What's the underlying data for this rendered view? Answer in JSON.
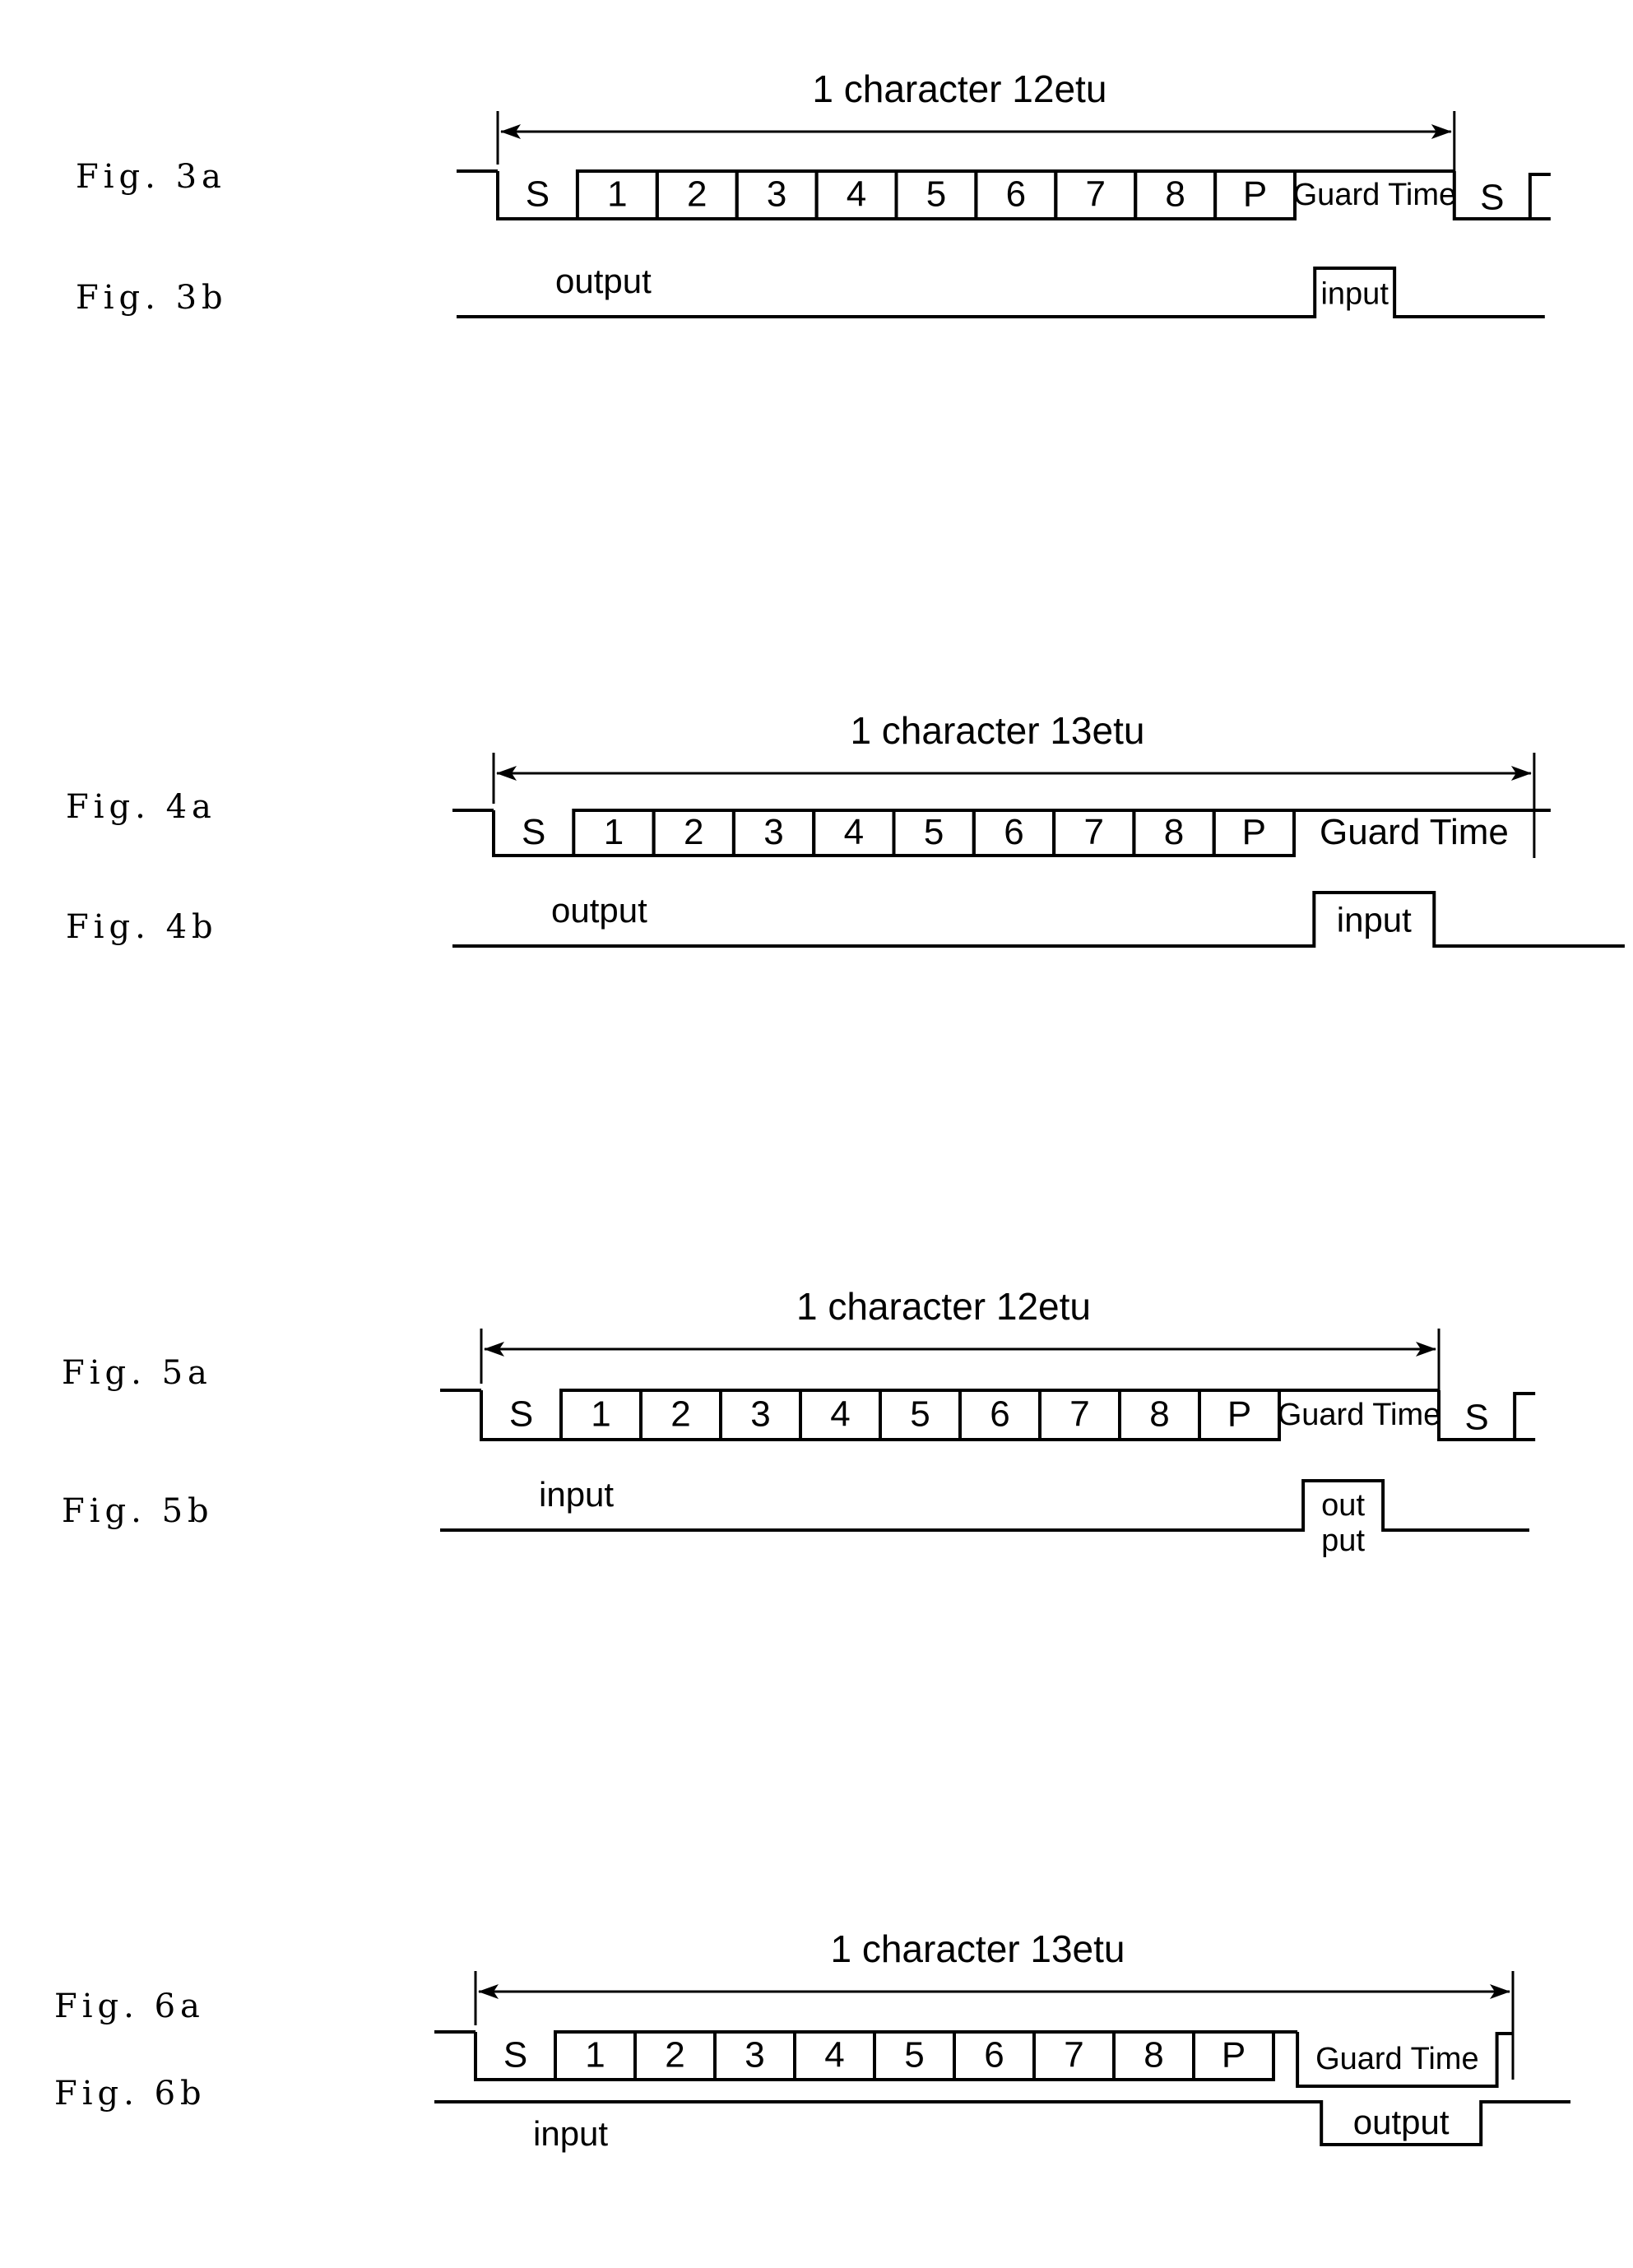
{
  "page": {
    "background": "#ffffff",
    "ink": "#000000"
  },
  "figures": [
    {
      "id": "fig3",
      "label_a": "Fig. 3a",
      "label_b": "Fig. 3b",
      "title": "1 character 12etu",
      "total_etu": 12,
      "cells": [
        "S",
        "1",
        "2",
        "3",
        "4",
        "5",
        "6",
        "7",
        "8",
        "P"
      ],
      "guard_label": "Guard Time",
      "guard_etu": 2,
      "next_start": true,
      "next_start_label": "S",
      "guard_boxed": false,
      "row_b_main_label": "output",
      "row_b_pulse_label": "input",
      "row_b_pulse_direction": "up",
      "row_b_pulse_width_etu": 1
    },
    {
      "id": "fig4",
      "label_a": "Fig. 4a",
      "label_b": "Fig. 4b",
      "title": "1 character 13etu",
      "total_etu": 13,
      "cells": [
        "S",
        "1",
        "2",
        "3",
        "4",
        "5",
        "6",
        "7",
        "8",
        "P"
      ],
      "guard_label": "Guard Time",
      "guard_etu": 3,
      "next_start": false,
      "guard_boxed": false,
      "row_b_main_label": "output",
      "row_b_pulse_label": "input",
      "row_b_pulse_direction": "up",
      "row_b_pulse_width_etu": 1.5
    },
    {
      "id": "fig5",
      "label_a": "Fig. 5a",
      "label_b": "Fig. 5b",
      "title": "1 character 12etu",
      "total_etu": 12,
      "cells": [
        "S",
        "1",
        "2",
        "3",
        "4",
        "5",
        "6",
        "7",
        "8",
        "P"
      ],
      "guard_label": "Guard Time",
      "guard_etu": 2,
      "next_start": true,
      "next_start_label": "S",
      "guard_boxed": false,
      "row_b_main_label": "input",
      "row_b_pulse_label": "out put",
      "row_b_pulse_label_lines": [
        "out",
        "put"
      ],
      "row_b_pulse_direction": "up",
      "row_b_pulse_width_etu": 1
    },
    {
      "id": "fig6",
      "label_a": "Fig. 6a",
      "label_b": "Fig. 6b",
      "title": "1 character 13etu",
      "total_etu": 13,
      "cells": [
        "S",
        "1",
        "2",
        "3",
        "4",
        "5",
        "6",
        "7",
        "8",
        "P"
      ],
      "guard_label": "Guard Time",
      "guard_etu": 3,
      "next_start": false,
      "guard_boxed": true,
      "row_b_main_label": "input",
      "row_b_pulse_label": "output",
      "row_b_pulse_direction": "down",
      "row_b_pulse_width_etu": 2
    }
  ]
}
